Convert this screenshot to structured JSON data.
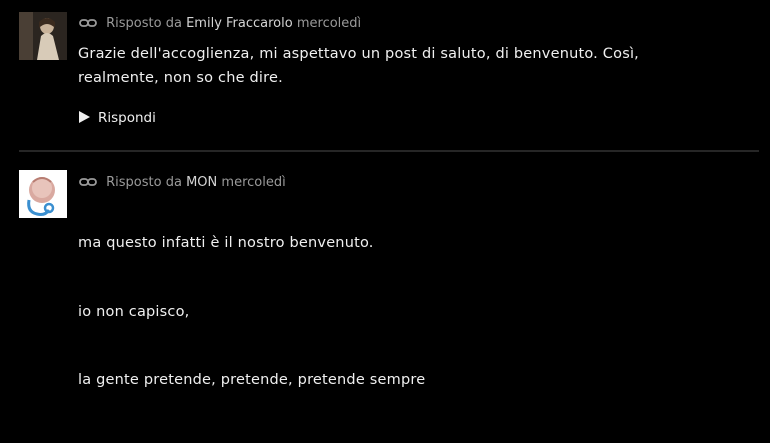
{
  "replies": [
    {
      "meta_prefix": "Risposto da",
      "author": "Emily Fraccarolo",
      "date": "mercoledì",
      "text": "Grazie dell'accoglienza, mi aspettavo un post di saluto, di benvenuto. Così, realmente, non so che dire.",
      "reply_label": "Rispondi"
    },
    {
      "meta_prefix": "Risposto da",
      "author": "MON",
      "date": "mercoledì",
      "paragraphs": [
        "ma questo infatti è il nostro benvenuto.",
        "io non capisco,",
        "la gente pretende, pretende, pretende sempre"
      ]
    }
  ],
  "icons": {
    "permalink": "link-icon",
    "reply": "triangle-right-icon"
  },
  "colors": {
    "background": "#000000",
    "meta_text": "#9a9a9a",
    "body_text": "#f0f0f0",
    "divider": "#262626"
  }
}
